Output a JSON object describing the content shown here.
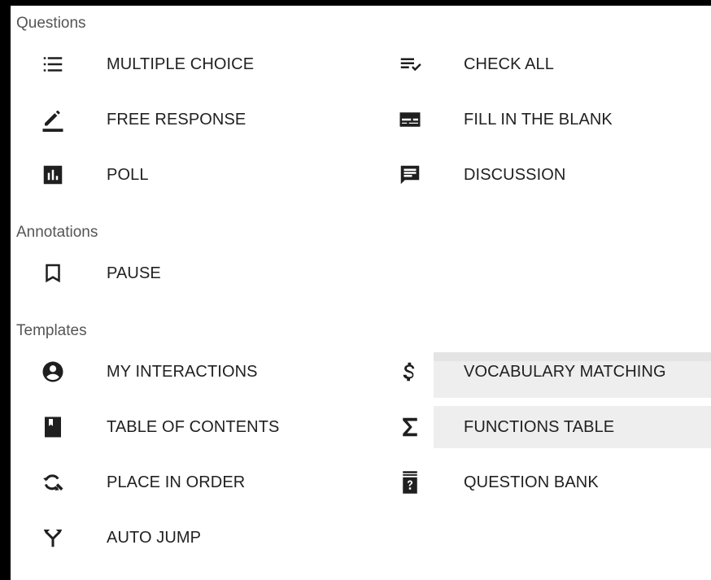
{
  "sections": {
    "questions": "Questions",
    "annotations": "Annotations",
    "templates": "Templates"
  },
  "items": {
    "multiple_choice": {
      "label": "MULTIPLE CHOICE",
      "icon": "list-icon"
    },
    "check_all": {
      "label": "CHECK ALL",
      "icon": "checklist-icon"
    },
    "free_response": {
      "label": "FREE RESPONSE",
      "icon": "pencil-icon"
    },
    "fill_in_the_blank": {
      "label": "FILL IN THE BLANK",
      "icon": "blank-field-icon"
    },
    "poll": {
      "label": "POLL",
      "icon": "poll-chart-icon"
    },
    "discussion": {
      "label": "DISCUSSION",
      "icon": "chat-icon"
    },
    "pause": {
      "label": "PAUSE",
      "icon": "bookmark-icon"
    },
    "my_interactions": {
      "label": "MY INTERACTIONS",
      "icon": "account-circle-icon"
    },
    "vocabulary_matching": {
      "label": "VOCABULARY MATCHING",
      "icon": "dollar-icon"
    },
    "table_of_contents": {
      "label": "TABLE OF CONTENTS",
      "icon": "book-icon"
    },
    "functions_table": {
      "label": "FUNCTIONS TABLE",
      "icon": "sigma-icon"
    },
    "place_in_order": {
      "label": "PLACE IN ORDER",
      "icon": "reorder-search-icon"
    },
    "question_bank": {
      "label": "QUESTION BANK",
      "icon": "question-bank-icon"
    },
    "auto_jump": {
      "label": "AUTO JUMP",
      "icon": "merge-arrows-icon"
    }
  },
  "colors": {
    "icon": "#1f1f1f",
    "text": "#212121",
    "section": "#555555",
    "hover": "#eeeeee"
  }
}
